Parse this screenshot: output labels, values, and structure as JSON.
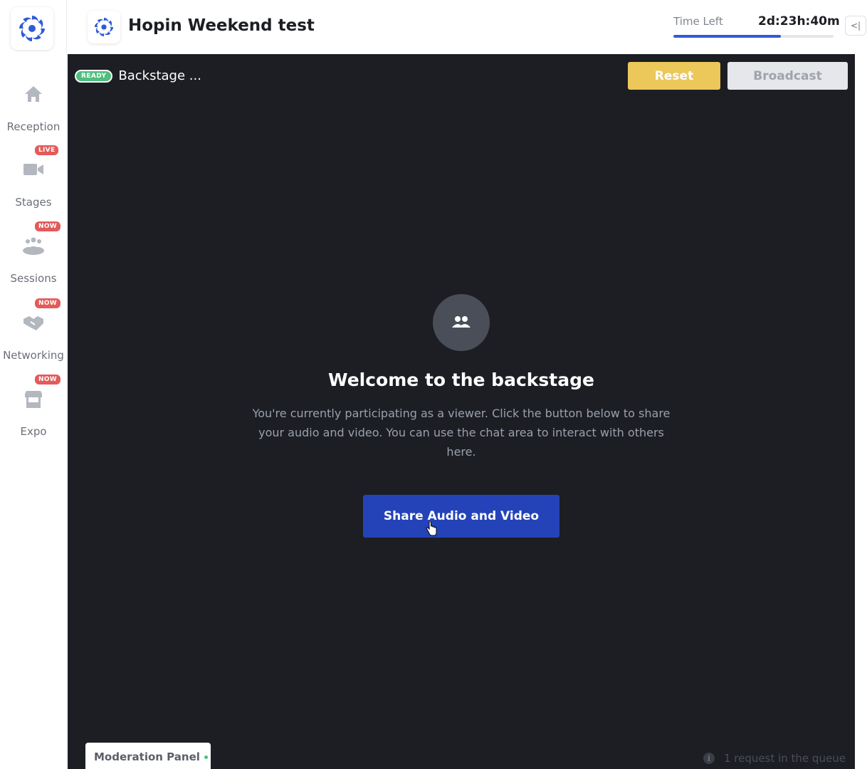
{
  "event": {
    "title": "Hopin Weekend test"
  },
  "timer": {
    "label": "Time Left",
    "value": "2d:23h:40m",
    "progress_fraction": 0.67
  },
  "sidebar": {
    "items": [
      {
        "label": "Reception",
        "icon": "home-icon",
        "badge": ""
      },
      {
        "label": "Stages",
        "icon": "video-camera-icon",
        "badge": "LIVE"
      },
      {
        "label": "Sessions",
        "icon": "people-group-icon",
        "badge": "NOW"
      },
      {
        "label": "Networking",
        "icon": "handshake-icon",
        "badge": "NOW"
      },
      {
        "label": "Expo",
        "icon": "booth-icon",
        "badge": "NOW"
      }
    ]
  },
  "stage": {
    "status": "READY",
    "name": "Backstage ...",
    "reset_label": "Reset",
    "broadcast_label": "Broadcast",
    "welcome_title": "Welcome to the backstage",
    "welcome_description": "You're currently participating as a viewer. Click the button below to share your audio and video. You can use the chat area to interact with others here.",
    "share_label": "Share Audio and Video",
    "moderation_label": "Moderation Panel",
    "queue_text": "1 request in the queue"
  },
  "colors": {
    "accent": "#2f5bd8",
    "stage_bg": "#1c1e24",
    "reset": "#ecc75a",
    "share": "#2443b8",
    "live_badge": "#e35a5a",
    "ready_badge": "#4fbf7e"
  }
}
